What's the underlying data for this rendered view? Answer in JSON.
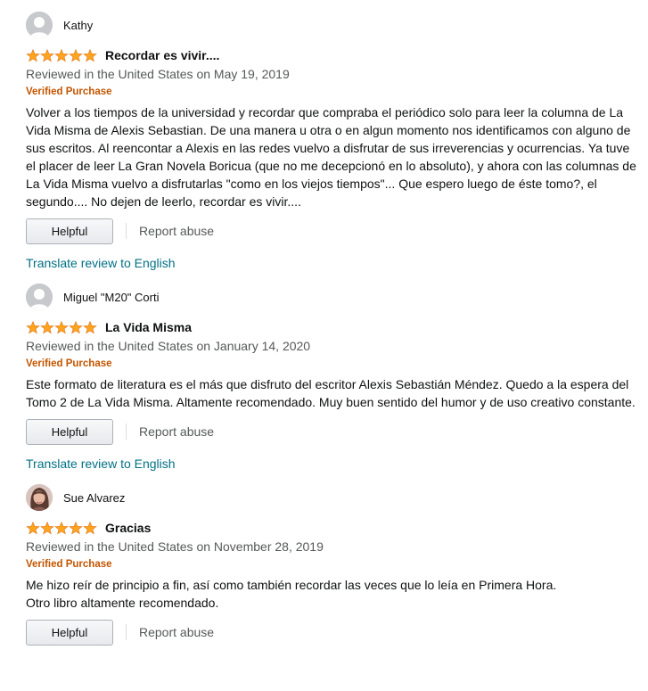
{
  "reviews": [
    {
      "name": "Kathy",
      "avatar": "default-avatar",
      "rating": 5,
      "title": "Recordar es vivir....",
      "meta": "Reviewed in the United States on May 19, 2019",
      "verified": "Verified Purchase",
      "body": "Volver a los tiempos de la universidad y recordar que compraba el periódico solo para leer la columna de La Vida Misma de Alexis Sebastian. De una manera u otra o en algun momento nos identificamos con alguno de sus escritos. Al reencontar a Alexis en las redes vuelvo a disfrutar de sus irreverencias y ocurrencias. Ya tuve el placer de leer La Gran Novela Boricua (que no me decepcionó en lo absoluto), y ahora con las columnas de La Vida Misma vuelvo a disfrutarlas \"como en los viejos tiempos\"... Que espero luego de éste tomo?, el segundo.... No dejen de leerlo, recordar es vivir....",
      "helpful": "Helpful",
      "report": "Report abuse",
      "translate": "Translate review to English"
    },
    {
      "name": "Miguel \"M20\" Corti",
      "avatar": "default-avatar",
      "rating": 5,
      "title": "La Vida Misma",
      "meta": "Reviewed in the United States on January 14, 2020",
      "verified": "Verified Purchase",
      "body": "Este formato de literatura es el más que disfruto del escritor Alexis Sebastián Méndez. Quedo a la espera del Tomo 2 de La Vida Misma. Altamente recomendado. Muy buen sentido del humor y de uso creativo constante.",
      "helpful": "Helpful",
      "report": "Report abuse",
      "translate": "Translate review to English"
    },
    {
      "name": "Sue Alvarez",
      "avatar": "photo-avatar",
      "rating": 5,
      "title": "Gracias",
      "meta": "Reviewed in the United States on November 28, 2019",
      "verified": "Verified Purchase",
      "body": "Me hizo reír de principio a fin, así como también recordar las veces que lo leía en Primera Hora.\nOtro libro altamente recomendado.",
      "helpful": "Helpful",
      "report": "Report abuse"
    }
  ],
  "colors": {
    "star": "#ffa41c",
    "verified": "#c45500",
    "link": "#007185",
    "meta": "#565959"
  }
}
